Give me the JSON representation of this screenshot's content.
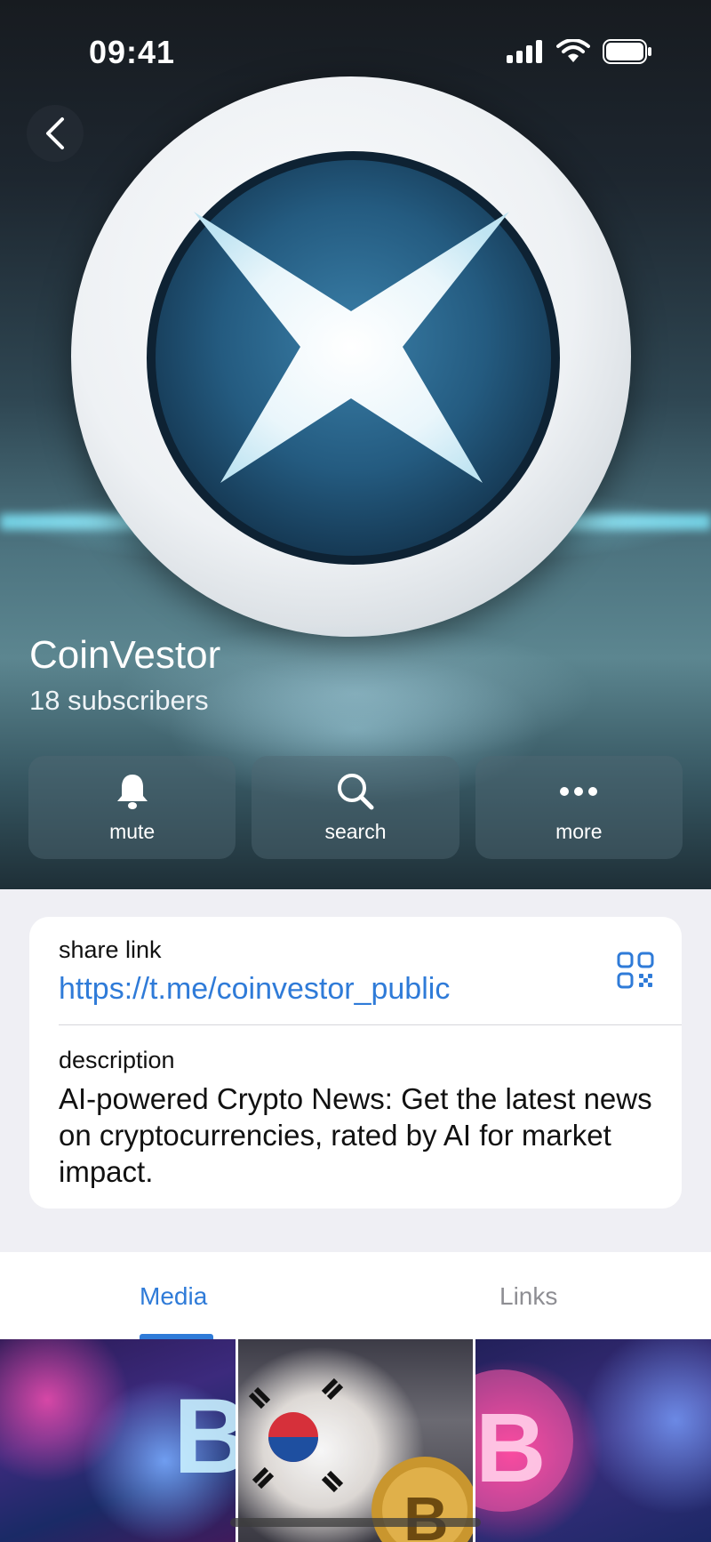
{
  "status_bar": {
    "time": "09:41"
  },
  "channel": {
    "name": "CoinVestor",
    "subscribers": "18 subscribers"
  },
  "actions": [
    {
      "label": "mute",
      "icon": "bell-icon"
    },
    {
      "label": "search",
      "icon": "search-icon"
    },
    {
      "label": "more",
      "icon": "more-icon"
    }
  ],
  "info": {
    "share_label": "share link",
    "share_url": "https://t.me/coinvestor_public",
    "description_label": "description",
    "description": "AI-powered Crypto News: Get the latest news on cryptocurrencies, rated by AI for market impact."
  },
  "tabs": [
    {
      "label": "Media",
      "active": true
    },
    {
      "label": "Links",
      "active": false
    }
  ],
  "colors": {
    "accent": "#2f7bd8",
    "background": "#efeff4"
  }
}
